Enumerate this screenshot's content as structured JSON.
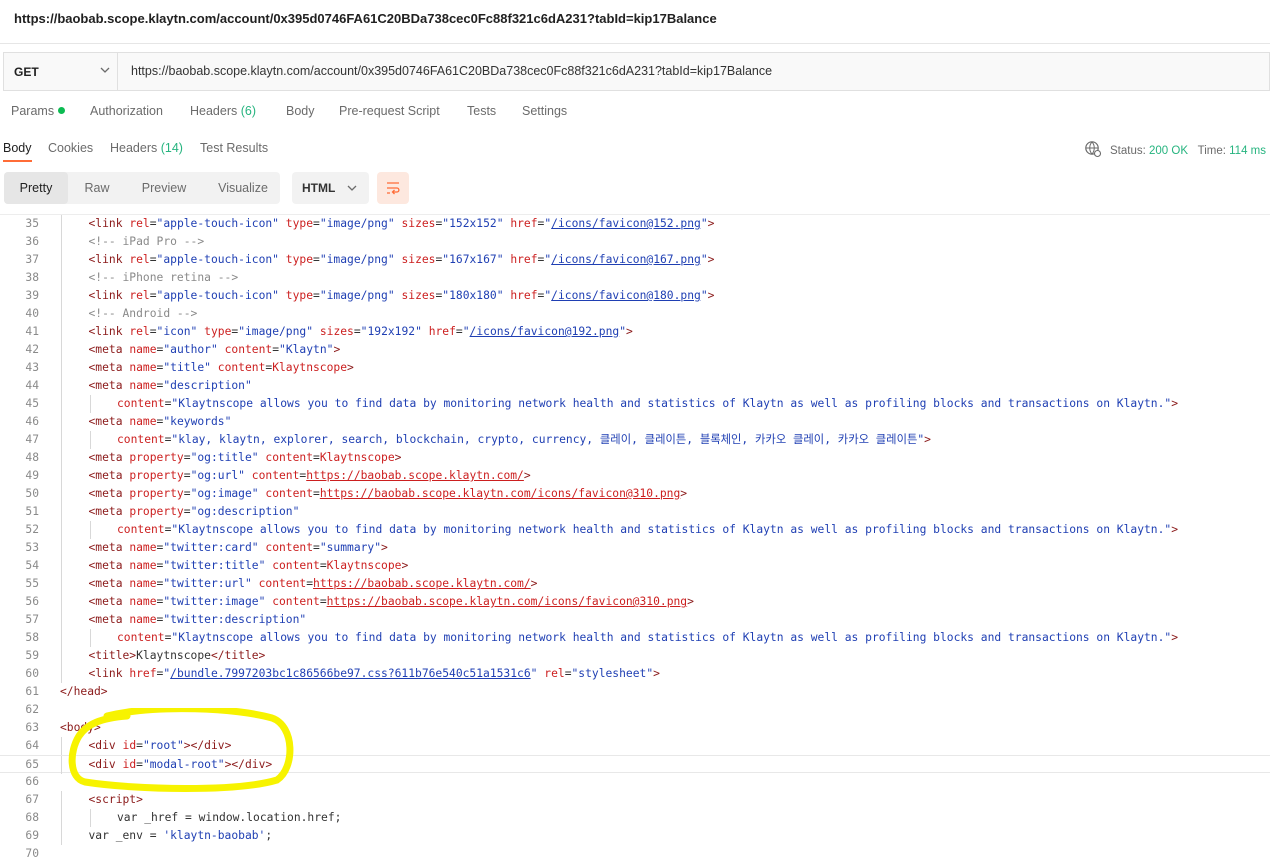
{
  "window_title": "https://baobab.scope.klaytn.com/account/0x395d0746FA61C20BDa738cec0Fc88f321c6dA231?tabId=kip17Balance",
  "request": {
    "method": "GET",
    "url": "https://baobab.scope.klaytn.com/account/0x395d0746FA61C20BDa738cec0Fc88f321c6dA231?tabId=kip17Balance"
  },
  "request_tabs": [
    {
      "label": "Params",
      "count": ""
    },
    {
      "label": "Authorization",
      "count": ""
    },
    {
      "label": "Headers",
      "count": "(6)"
    },
    {
      "label": "Body",
      "count": ""
    },
    {
      "label": "Pre-request Script",
      "count": ""
    },
    {
      "label": "Tests",
      "count": ""
    },
    {
      "label": "Settings",
      "count": ""
    }
  ],
  "response_tabs": [
    {
      "label": "Body",
      "count": ""
    },
    {
      "label": "Cookies",
      "count": ""
    },
    {
      "label": "Headers",
      "count": "(14)"
    },
    {
      "label": "Test Results",
      "count": ""
    }
  ],
  "status": {
    "status_label": "Status:",
    "status_value": "200 OK",
    "time_label": "Time:",
    "time_value": "114 ms"
  },
  "view_modes": [
    "Pretty",
    "Raw",
    "Preview",
    "Visualize"
  ],
  "active_view": "Pretty",
  "format": "HTML",
  "icons": {
    "method_dropdown": "chevron-down-icon",
    "format_dropdown": "chevron-down-icon",
    "wrap": "wrap-lines-icon",
    "network": "globe-icon"
  },
  "colors": {
    "accent": "#ff6c37",
    "success": "#26b47f",
    "annotation_highlight": "#f7f300"
  },
  "code_lines": [
    {
      "n": "35",
      "indent": 2,
      "html": "<span class=\"t\">&lt;link</span> <span class=\"a\">rel</span><span class=\"p\">=</span><span class=\"v\">\"apple-touch-icon\"</span> <span class=\"a\">type</span><span class=\"p\">=</span><span class=\"v\">\"image/png\"</span> <span class=\"a\">sizes</span><span class=\"p\">=</span><span class=\"v\">\"152x152\"</span> <span class=\"a\">href</span><span class=\"p\">=</span><span class=\"v\">\"</span><span class=\"u\">/icons/favicon@152.png</span><span class=\"v\">\"</span><span class=\"t\">&gt;</span>"
    },
    {
      "n": "36",
      "indent": 2,
      "html": "<span class=\"c\">&lt;!-- iPad Pro --&gt;</span>"
    },
    {
      "n": "37",
      "indent": 2,
      "html": "<span class=\"t\">&lt;link</span> <span class=\"a\">rel</span><span class=\"p\">=</span><span class=\"v\">\"apple-touch-icon\"</span> <span class=\"a\">type</span><span class=\"p\">=</span><span class=\"v\">\"image/png\"</span> <span class=\"a\">sizes</span><span class=\"p\">=</span><span class=\"v\">\"167x167\"</span> <span class=\"a\">href</span><span class=\"p\">=</span><span class=\"v\">\"</span><span class=\"u\">/icons/favicon@167.png</span><span class=\"v\">\"</span><span class=\"t\">&gt;</span>"
    },
    {
      "n": "38",
      "indent": 2,
      "html": "<span class=\"c\">&lt;!-- iPhone retina --&gt;</span>"
    },
    {
      "n": "39",
      "indent": 2,
      "html": "<span class=\"t\">&lt;link</span> <span class=\"a\">rel</span><span class=\"p\">=</span><span class=\"v\">\"apple-touch-icon\"</span> <span class=\"a\">type</span><span class=\"p\">=</span><span class=\"v\">\"image/png\"</span> <span class=\"a\">sizes</span><span class=\"p\">=</span><span class=\"v\">\"180x180\"</span> <span class=\"a\">href</span><span class=\"p\">=</span><span class=\"v\">\"</span><span class=\"u\">/icons/favicon@180.png</span><span class=\"v\">\"</span><span class=\"t\">&gt;</span>"
    },
    {
      "n": "40",
      "indent": 2,
      "html": "<span class=\"c\">&lt;!-- Android --&gt;</span>"
    },
    {
      "n": "41",
      "indent": 2,
      "html": "<span class=\"t\">&lt;link</span> <span class=\"a\">rel</span><span class=\"p\">=</span><span class=\"v\">\"icon\"</span> <span class=\"a\">type</span><span class=\"p\">=</span><span class=\"v\">\"image/png\"</span> <span class=\"a\">sizes</span><span class=\"p\">=</span><span class=\"v\">\"192x192\"</span> <span class=\"a\">href</span><span class=\"p\">=</span><span class=\"v\">\"</span><span class=\"u\">/icons/favicon@192.png</span><span class=\"v\">\"</span><span class=\"t\">&gt;</span>"
    },
    {
      "n": "42",
      "indent": 2,
      "html": "<span class=\"t\">&lt;meta</span> <span class=\"a\">name</span><span class=\"p\">=</span><span class=\"v\">\"author\"</span> <span class=\"a\">content</span><span class=\"p\">=</span><span class=\"v\">\"Klaytn\"</span><span class=\"t\">&gt;</span>"
    },
    {
      "n": "43",
      "indent": 2,
      "html": "<span class=\"t\">&lt;meta</span> <span class=\"a\">name</span><span class=\"p\">=</span><span class=\"v\">\"title\"</span> <span class=\"a\">content</span><span class=\"p\">=</span><span class=\"a\">Klaytnscope</span><span class=\"t\">&gt;</span>"
    },
    {
      "n": "44",
      "indent": 2,
      "html": "<span class=\"t\">&lt;meta</span> <span class=\"a\">name</span><span class=\"p\">=</span><span class=\"v\">\"description\"</span>"
    },
    {
      "n": "45",
      "indent": 3,
      "html": "<span class=\"a\">content</span><span class=\"p\">=</span><span class=\"v\">\"Klaytnscope allows you to find data by monitoring network health and statistics of Klaytn as well as profiling blocks and transactions on Klaytn.\"</span><span class=\"t\">&gt;</span>"
    },
    {
      "n": "46",
      "indent": 2,
      "html": "<span class=\"t\">&lt;meta</span> <span class=\"a\">name</span><span class=\"p\">=</span><span class=\"v\">\"keywords\"</span>"
    },
    {
      "n": "47",
      "indent": 3,
      "html": "<span class=\"a\">content</span><span class=\"p\">=</span><span class=\"v\">\"klay, klaytn, explorer, search, blockchain, crypto, currency, 클레이, 클레이튼, 블록체인, 카카오 클레이, 카카오 클레이튼\"</span><span class=\"t\">&gt;</span>"
    },
    {
      "n": "48",
      "indent": 2,
      "html": "<span class=\"t\">&lt;meta</span> <span class=\"a\">property</span><span class=\"p\">=</span><span class=\"v\">\"og:title\"</span> <span class=\"a\">content</span><span class=\"p\">=</span><span class=\"a\">Klaytnscope</span><span class=\"t\">&gt;</span>"
    },
    {
      "n": "49",
      "indent": 2,
      "html": "<span class=\"t\">&lt;meta</span> <span class=\"a\">property</span><span class=\"p\">=</span><span class=\"v\">\"og:url\"</span> <span class=\"a\">content</span><span class=\"p\">=</span><span class=\"ur\">https://baobab.scope.klaytn.com/</span><span class=\"t\">&gt;</span>"
    },
    {
      "n": "50",
      "indent": 2,
      "html": "<span class=\"t\">&lt;meta</span> <span class=\"a\">property</span><span class=\"p\">=</span><span class=\"v\">\"og:image\"</span> <span class=\"a\">content</span><span class=\"p\">=</span><span class=\"ur\">https://baobab.scope.klaytn.com/icons/favicon@310.png</span><span class=\"t\">&gt;</span>"
    },
    {
      "n": "51",
      "indent": 2,
      "html": "<span class=\"t\">&lt;meta</span> <span class=\"a\">property</span><span class=\"p\">=</span><span class=\"v\">\"og:description\"</span>"
    },
    {
      "n": "52",
      "indent": 3,
      "html": "<span class=\"a\">content</span><span class=\"p\">=</span><span class=\"v\">\"Klaytnscope allows you to find data by monitoring network health and statistics of Klaytn as well as profiling blocks and transactions on Klaytn.\"</span><span class=\"t\">&gt;</span>"
    },
    {
      "n": "53",
      "indent": 2,
      "html": "<span class=\"t\">&lt;meta</span> <span class=\"a\">name</span><span class=\"p\">=</span><span class=\"v\">\"twitter:card\"</span> <span class=\"a\">content</span><span class=\"p\">=</span><span class=\"v\">\"summary\"</span><span class=\"t\">&gt;</span>"
    },
    {
      "n": "54",
      "indent": 2,
      "html": "<span class=\"t\">&lt;meta</span> <span class=\"a\">name</span><span class=\"p\">=</span><span class=\"v\">\"twitter:title\"</span> <span class=\"a\">content</span><span class=\"p\">=</span><span class=\"a\">Klaytnscope</span><span class=\"t\">&gt;</span>"
    },
    {
      "n": "55",
      "indent": 2,
      "html": "<span class=\"t\">&lt;meta</span> <span class=\"a\">name</span><span class=\"p\">=</span><span class=\"v\">\"twitter:url\"</span> <span class=\"a\">content</span><span class=\"p\">=</span><span class=\"ur\">https://baobab.scope.klaytn.com/</span><span class=\"t\">&gt;</span>"
    },
    {
      "n": "56",
      "indent": 2,
      "html": "<span class=\"t\">&lt;meta</span> <span class=\"a\">name</span><span class=\"p\">=</span><span class=\"v\">\"twitter:image\"</span> <span class=\"a\">content</span><span class=\"p\">=</span><span class=\"ur\">https://baobab.scope.klaytn.com/icons/favicon@310.png</span><span class=\"t\">&gt;</span>"
    },
    {
      "n": "57",
      "indent": 2,
      "html": "<span class=\"t\">&lt;meta</span> <span class=\"a\">name</span><span class=\"p\">=</span><span class=\"v\">\"twitter:description\"</span>"
    },
    {
      "n": "58",
      "indent": 3,
      "html": "<span class=\"a\">content</span><span class=\"p\">=</span><span class=\"v\">\"Klaytnscope allows you to find data by monitoring network health and statistics of Klaytn as well as profiling blocks and transactions on Klaytn.\"</span><span class=\"t\">&gt;</span>"
    },
    {
      "n": "59",
      "indent": 2,
      "html": "<span class=\"t\">&lt;title&gt;</span><span class=\"p\">Klaytnscope</span><span class=\"t\">&lt;/title&gt;</span>"
    },
    {
      "n": "60",
      "indent": 2,
      "html": "<span class=\"t\">&lt;link</span> <span class=\"a\">href</span><span class=\"p\">=</span><span class=\"v\">\"</span><span class=\"u\">/bundle.7997203bc1c86566be97.css?611b76e540c51a1531c6</span><span class=\"v\">\"</span> <span class=\"a\">rel</span><span class=\"p\">=</span><span class=\"v\">\"stylesheet\"</span><span class=\"t\">&gt;</span>"
    },
    {
      "n": "61",
      "indent": 1,
      "html": "<span class=\"t\">&lt;/head&gt;</span>"
    },
    {
      "n": "62",
      "indent": 0,
      "html": ""
    },
    {
      "n": "63",
      "indent": 1,
      "html": "<span class=\"t\">&lt;body&gt;</span>"
    },
    {
      "n": "64",
      "indent": 2,
      "html": "<span class=\"t\">&lt;div</span> <span class=\"a\">id</span><span class=\"p\">=</span><span class=\"v\">\"root\"</span><span class=\"t\">&gt;&lt;/div&gt;</span>"
    },
    {
      "n": "65",
      "indent": 2,
      "html": "<span class=\"t\">&lt;div</span> <span class=\"a\">id</span><span class=\"p\">=</span><span class=\"v\">\"modal-root\"</span><span class=\"t\">&gt;&lt;/div&gt;</span>"
    },
    {
      "n": "66",
      "indent": 0,
      "html": ""
    },
    {
      "n": "67",
      "indent": 2,
      "html": "<span class=\"t\">&lt;script&gt;</span>"
    },
    {
      "n": "68",
      "indent": 3,
      "html": "<span class=\"p\">var _href = window.location.href;</span>"
    },
    {
      "n": "69",
      "indent": 2,
      "html": "<span class=\"p\">var _env = </span><span class=\"v\">'klaytn-baobab'</span><span class=\"p\">;</span>"
    },
    {
      "n": "70",
      "indent": 0,
      "html": ""
    }
  ]
}
